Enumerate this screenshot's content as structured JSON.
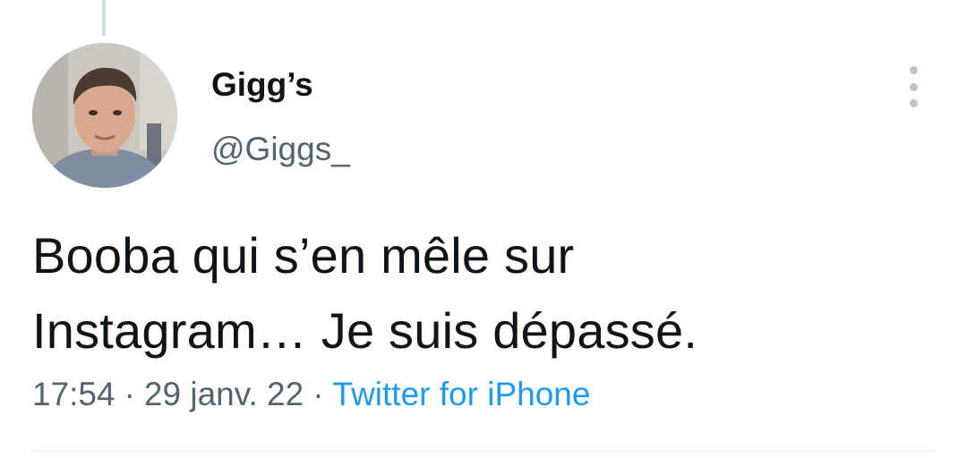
{
  "tweet": {
    "display_name": "Gigg’s",
    "handle": "@Giggs_",
    "text_line1": "Booba qui s’en mêle sur",
    "text_line2": "Instagram… Je suis dépassé.",
    "time": "17:54",
    "date": "29 janv. 22",
    "separator": "·",
    "source": "Twitter for iPhone"
  },
  "colors": {
    "text": "#0f1419",
    "secondary": "#536471",
    "link": "#1d9bf0",
    "thread_line": "#cfd9de"
  },
  "icons": {
    "more": "more-vertical-icon"
  }
}
